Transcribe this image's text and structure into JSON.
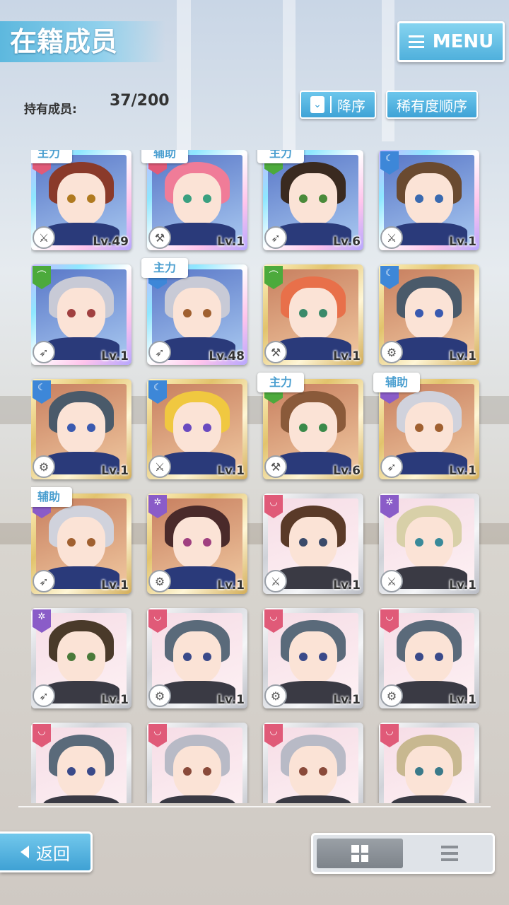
{
  "header": {
    "title": "在籍成员",
    "menu_label": "MENU"
  },
  "member_count": {
    "label": "持有成员:",
    "value": "37/200"
  },
  "sort": {
    "order_label": "降序",
    "rarity_label": "稀有度顺序"
  },
  "colors": {
    "accent": "#4fb0dc",
    "role_text": "#4b9fd0",
    "red": "#e05a78",
    "green": "#4caa3c",
    "blue": "#3d87d8",
    "purple": "#8a5cc8"
  },
  "cards": [
    {
      "role": "主力",
      "level": "Lv.49",
      "frame": "rainbow",
      "attr": "red",
      "weapon": "sword",
      "hair": "#8a3a2a",
      "eye": "#b07a20"
    },
    {
      "role": "辅助",
      "level": "Lv.1",
      "frame": "rainbow",
      "attr": "red",
      "weapon": "hammer",
      "hair": "#f07c98",
      "eye": "#3aa080"
    },
    {
      "role": "主力",
      "level": "Lv.6",
      "frame": "rainbow",
      "attr": "green",
      "weapon": "lance",
      "hair": "#3a2a20",
      "eye": "#4a8a3a"
    },
    {
      "role": "",
      "level": "Lv.1",
      "frame": "rainbow",
      "attr": "blue",
      "weapon": "sword",
      "hair": "#6a4a30",
      "eye": "#3a6ab0"
    },
    {
      "role": "",
      "level": "Lv.1",
      "frame": "rainbow",
      "attr": "green",
      "weapon": "lance",
      "hair": "#c8cad6",
      "eye": "#a04040"
    },
    {
      "role": "主力",
      "level": "Lv.48",
      "frame": "rainbow",
      "attr": "blue",
      "weapon": "lance",
      "hair": "#c8cad6",
      "eye": "#a06030"
    },
    {
      "role": "",
      "level": "Lv.1",
      "frame": "gold",
      "attr": "green",
      "weapon": "hammer",
      "hair": "#e8704a",
      "eye": "#3a8a6a"
    },
    {
      "role": "",
      "level": "Lv.1",
      "frame": "gold",
      "attr": "blue",
      "weapon": "gear",
      "hair": "#4a5a6a",
      "eye": "#3a5ab0"
    },
    {
      "role": "",
      "level": "Lv.1",
      "frame": "gold",
      "attr": "blue",
      "weapon": "gear",
      "hair": "#4a5a6a",
      "eye": "#3a5ab0"
    },
    {
      "role": "",
      "level": "Lv.1",
      "frame": "gold",
      "attr": "blue",
      "weapon": "sword",
      "hair": "#f0c840",
      "eye": "#6a4ac0"
    },
    {
      "role": "主力",
      "level": "Lv.6",
      "frame": "gold",
      "attr": "green",
      "weapon": "hammer",
      "hair": "#8a5a3a",
      "eye": "#3a8a4a"
    },
    {
      "role": "辅助",
      "level": "Lv.1",
      "frame": "gold",
      "attr": "purple",
      "weapon": "lance",
      "hair": "#d0d2dc",
      "eye": "#a06030"
    },
    {
      "role": "辅助",
      "level": "Lv.1",
      "frame": "gold",
      "attr": "purple",
      "weapon": "lance",
      "hair": "#d0d2dc",
      "eye": "#a06030"
    },
    {
      "role": "",
      "level": "Lv.1",
      "frame": "gold",
      "attr": "purple",
      "weapon": "gear",
      "hair": "#4a2a2a",
      "eye": "#a04080"
    },
    {
      "role": "",
      "level": "Lv.1",
      "frame": "silver",
      "attr": "red",
      "weapon": "sword",
      "hair": "#5a3a28",
      "eye": "#3a4a6a"
    },
    {
      "role": "",
      "level": "Lv.1",
      "frame": "silver",
      "attr": "purple",
      "weapon": "sword",
      "hair": "#d8d0a8",
      "eye": "#3a8a9a"
    },
    {
      "role": "",
      "level": "Lv.1",
      "frame": "silver",
      "attr": "purple",
      "weapon": "lance",
      "hair": "#4a3a2a",
      "eye": "#4a7a3a"
    },
    {
      "role": "",
      "level": "Lv.1",
      "frame": "silver",
      "attr": "red",
      "weapon": "gear",
      "hair": "#5a6a7a",
      "eye": "#3a4a8a"
    },
    {
      "role": "",
      "level": "Lv.1",
      "frame": "silver",
      "attr": "red",
      "weapon": "gear",
      "hair": "#5a6a7a",
      "eye": "#3a4a8a"
    },
    {
      "role": "",
      "level": "Lv.1",
      "frame": "silver",
      "attr": "red",
      "weapon": "gear",
      "hair": "#5a6a7a",
      "eye": "#3a4a8a"
    },
    {
      "role": "",
      "level": "",
      "frame": "silver",
      "attr": "red",
      "weapon": "",
      "hair": "#5a6a7a",
      "eye": "#3a4a8a"
    },
    {
      "role": "",
      "level": "",
      "frame": "silver",
      "attr": "red",
      "weapon": "",
      "hair": "#b8bac6",
      "eye": "#8a4a3a"
    },
    {
      "role": "",
      "level": "",
      "frame": "silver",
      "attr": "red",
      "weapon": "",
      "hair": "#b8bac6",
      "eye": "#8a4a3a"
    },
    {
      "role": "",
      "level": "",
      "frame": "silver",
      "attr": "red",
      "weapon": "",
      "hair": "#c8b890",
      "eye": "#3a7a8a"
    }
  ],
  "footer": {
    "back_label": "返回",
    "view_grid": "grid-view-icon",
    "view_list": "list-view-icon"
  }
}
